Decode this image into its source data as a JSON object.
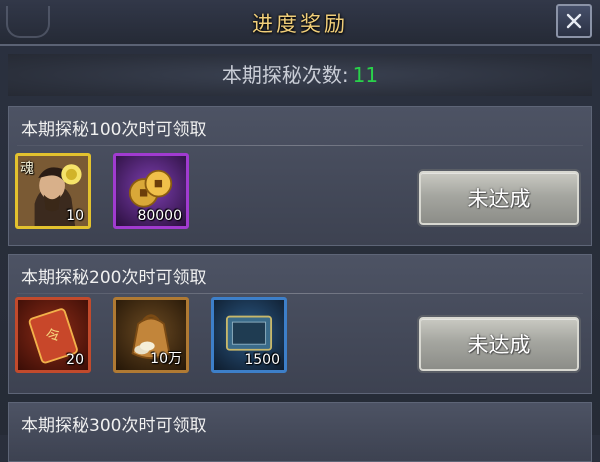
{
  "dialog": {
    "title": "进度奖励",
    "close_label": "X"
  },
  "summary": {
    "label": "本期探秘次数:",
    "count": "11"
  },
  "milestones": [
    {
      "heading": "本期探秘100次时可领取",
      "button_label": "未达成",
      "rewards": [
        {
          "icon": "hero-soul-icon",
          "tag": "魂",
          "quantity": "10",
          "frame": "gold"
        },
        {
          "icon": "copper-coins-icon",
          "quantity": "80000",
          "frame": "purple"
        }
      ]
    },
    {
      "heading": "本期探秘200次时可领取",
      "button_label": "未达成",
      "rewards": [
        {
          "icon": "command-token-icon",
          "quantity": "20",
          "frame": "red"
        },
        {
          "icon": "money-bag-icon",
          "quantity": "10万",
          "frame": "orange"
        },
        {
          "icon": "experience-book-icon",
          "quantity": "1500",
          "frame": "blue"
        }
      ]
    },
    {
      "heading": "本期探秘300次时可领取"
    }
  ],
  "colors": {
    "title": "#f1cf7a",
    "count_highlight": "#29d24a",
    "gold_frame": "#e3c22e",
    "purple_frame": "#a13bd0"
  }
}
